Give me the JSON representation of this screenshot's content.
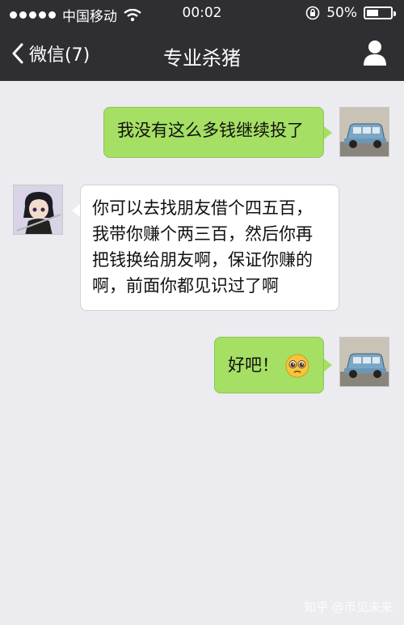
{
  "status": {
    "carrier": "中国移动",
    "time": "00:02",
    "battery": "50%",
    "battery_level": 0.5
  },
  "nav": {
    "back_label": "微信(7)",
    "title": "专业杀猪"
  },
  "messages": [
    {
      "from": "me",
      "text": "我没有这么多钱继续投了"
    },
    {
      "from": "them",
      "lines": [
        "你可以去找朋友借个四五百，",
        "我带你赚个两三百，然后你再",
        "把钱换给朋友啊，保证你赚的",
        "啊，前面你都见识过了啊"
      ]
    },
    {
      "from": "me",
      "text": "好吧！"
    }
  ],
  "watermark": "知乎 @币见未来",
  "colors": {
    "topbar": "#2f2f33",
    "me_bubble": "#a5e064",
    "background": "#ecebf0"
  }
}
